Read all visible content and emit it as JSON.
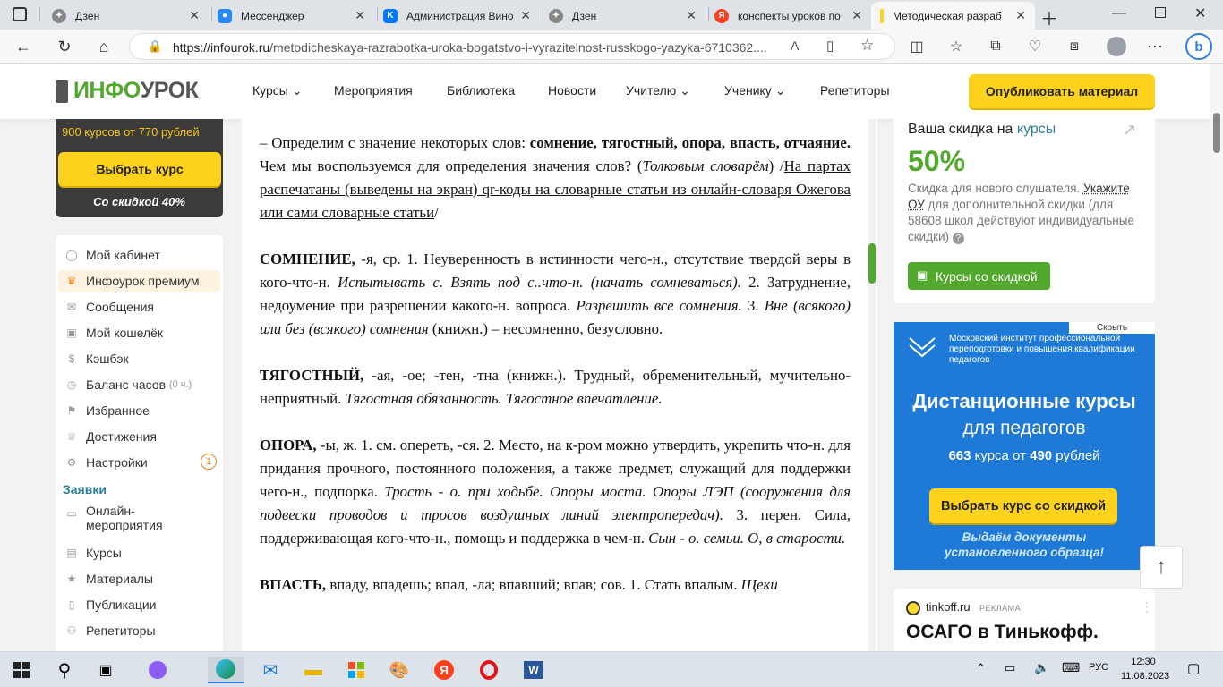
{
  "browser": {
    "tabs": [
      {
        "title": "Дзен",
        "icon": "dzen-icon",
        "color": "#888888"
      },
      {
        "title": "Мессенджер",
        "icon": "messenger-icon",
        "color": "#2787f5"
      },
      {
        "title": "Администрация Вино",
        "icon": "vk-icon",
        "color": "#0077ff"
      },
      {
        "title": "Дзен",
        "icon": "dzen-icon",
        "color": "#888888"
      },
      {
        "title": "конспекты уроков по",
        "icon": "yandex-icon",
        "color": "#fc3f1d"
      },
      {
        "title": "Методическая разраб",
        "icon": "infourok-icon",
        "color": "#ffd21e"
      }
    ],
    "url_host": "https://infourok.ru",
    "url_path": "/metodicheskaya-razrabotka-uroka-bogatstvo-i-vyrazitelnost-russkogo-yazyka-6710362...."
  },
  "site": {
    "logo_part1": "ИНФО",
    "logo_part2": "УРОК",
    "nav": [
      "Курсы",
      "Мероприятия",
      "Библиотека",
      "Новости",
      "Учителю",
      "Ученику",
      "Репетиторы"
    ],
    "publish_button": "Опубликовать материал"
  },
  "promo": {
    "count_colored": "900 курсов",
    "count_rest": " от 770 рублей",
    "button": "Выбрать курс",
    "discount": "Со скидкой 40%"
  },
  "menu": {
    "items": [
      {
        "label": "Мой кабинет",
        "icon": "user-icon"
      },
      {
        "label": "Инфоурок премиум",
        "icon": "crown-icon"
      },
      {
        "label": "Сообщения",
        "icon": "mail-icon"
      },
      {
        "label": "Мой кошелёк",
        "icon": "wallet-icon"
      },
      {
        "label": "Кэшбэк",
        "icon": "coin-icon"
      },
      {
        "label": "Баланс часов",
        "icon": "clock-icon",
        "suffix": "(0 ч.)"
      },
      {
        "label": "Избранное",
        "icon": "bookmark-icon"
      },
      {
        "label": "Достижения",
        "icon": "trophy-icon"
      },
      {
        "label": "Настройки",
        "icon": "gear-icon",
        "badge": "1"
      }
    ],
    "section_title": "Заявки",
    "section_items": [
      {
        "label": "Онлайн-мероприятия",
        "line1": "Онлайн-",
        "line2": "мероприятия",
        "icon": "video-icon"
      },
      {
        "label": "Курсы",
        "icon": "book-icon"
      },
      {
        "label": "Материалы",
        "icon": "star-icon"
      },
      {
        "label": "Публикации",
        "icon": "doc-icon"
      },
      {
        "label": "Репетиторы",
        "icon": "people-icon"
      }
    ]
  },
  "doc": {
    "p1_dash": "–    Определим с значение некоторых слов: ",
    "p1_bold": "сомнение, тягостный, опора, впасть, отчаяние.",
    "p1_q": " Чем мы воспользуемся для определения значения слов? (",
    "p1_it": "Толковым словарём",
    "p1_close": ") /",
    "p1_u": "На партах распечатаны (выведены на экран) qr-коды на словарные статьи из онлайн-словаря Ожегова или сами словарные статьи",
    "p1_end": "/",
    "p2_head": "СОМНЕНИЕ,",
    "p2_a": " -я, ср. 1. Неуверенность в истинности чего-н., отсутствие твердой веры в кого-что-н. ",
    "p2_b": "Испытывать с. Взять под с..что-н. (начать сомневаться).",
    "p2_c": " 2. Затруднение, недоумение при разрешении какого-н. вопроса. ",
    "p2_d": "Разрешить все сомнения.",
    "p2_e": " 3. ",
    "p2_f": "Вне (всякого) или без (всякого) сомнения",
    "p2_g": " (книжн.) – несомненно, безусловно.",
    "p3_head": "ТЯГОСТНЫЙ,",
    "p3_a": " -ая, -ое; -тен, -тна (книжн.). Трудный, обременительный, мучительно-неприятный. ",
    "p3_b": "Тягостная обязанность. Тягостное впечатление.",
    "p4_head": "ОПОРА,",
    "p4_a": " -ы, ж. 1. см. опереть, -ся. 2. Место, на к-ром можно утвердить, укрепить что-н. для придания прочного, постоянного положения, а также предмет, служащий для поддержки чего-н., подпорка. ",
    "p4_b": "Трость - о. при ходьбе. Опоры моста. Опоры ЛЭП (сооружения для подвески проводов и тросов воздушных линий электропередач).",
    "p4_c": " 3. перен. Сила, поддерживающая кого-что-н., помощь и поддержка в чем-н. ",
    "p4_d": "Сын - о. семьи. О, в старости.",
    "p5_head": "ВПАСТЬ,",
    "p5_a": " впаду, впадешь; впал, -ла; впавший; впав; сов. 1. Стать впалым. ",
    "p5_b": "Щеки"
  },
  "discount": {
    "title_a": "Ваша скидка на ",
    "title_b": "курсы",
    "percent": "50%",
    "desc_a": "Скидка для нового слушателя. ",
    "desc_link": "Укажите ОУ",
    "desc_b": " для дополнительной скидки (для 58608 школ действуют индивидуальные скидки)",
    "button": "Курсы со скидкой"
  },
  "ad": {
    "hide": "Скрыть",
    "org": "Московский институт профессиональной переподготовки и повышения квалификации педагогов",
    "title": "Дистанционные курсы",
    "subtitle": "для педагогов",
    "count_num": "663",
    "count_a": " курса от ",
    "count_price": "490",
    "count_b": " рублей",
    "button": "Выбрать курс со скидкой",
    "footer1": "Выдаём документы",
    "footer2": "установленного образца!"
  },
  "tinkoff": {
    "source": "tinkoff.ru",
    "label": "РЕКЛАМА",
    "title": "ОСАГО в Тинькофф."
  },
  "taskbar": {
    "lang": "РУС",
    "time": "12:30",
    "date": "11.08.2023"
  }
}
